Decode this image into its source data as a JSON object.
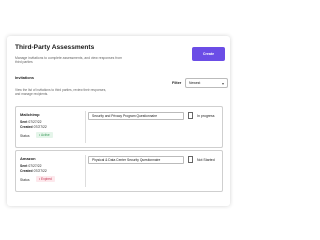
{
  "header": {
    "title": "Third-Party Assessments",
    "subtitle": "Manage invitations to complete assessments, and view responses from third parties",
    "create_label": "Create"
  },
  "invitations": {
    "heading": "Invitations",
    "description": "View the list of invitations to third parties, review their responses, and manage recipients.",
    "filter_label": "Filter",
    "filter_value": "Newest"
  },
  "rows": [
    {
      "vendor": "Mailchimp",
      "sent_label": "Sent",
      "sent": "07/27/22",
      "created_label": "Created",
      "created": "07/27/22",
      "status_label": "Status",
      "status": "Active",
      "questionnaire": "Security and Privacy Program Questionnaire",
      "progress": "In progress"
    },
    {
      "vendor": "Amazon",
      "sent_label": "Sent",
      "sent": "07/27/22",
      "created_label": "Created",
      "created": "07/27/22",
      "status_label": "Status",
      "status": "Expired",
      "questionnaire": "Physical & Data Center Security Questionnaire",
      "progress": "Not Started"
    }
  ],
  "colors": {
    "accent": "#6b4de6",
    "active": "#3a9a5a",
    "expired": "#c4324f"
  }
}
